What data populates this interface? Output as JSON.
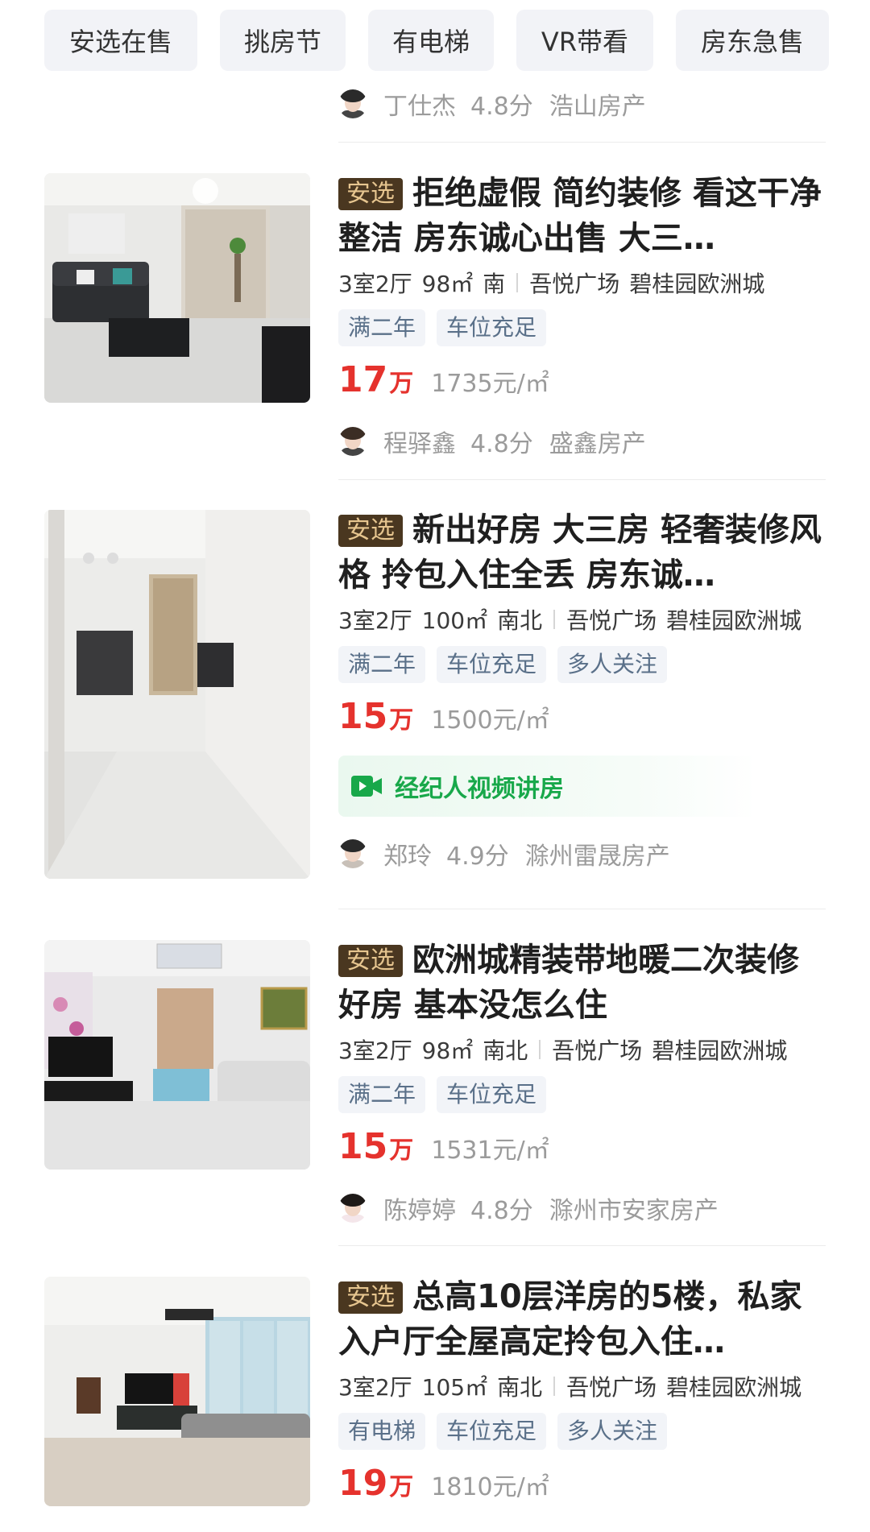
{
  "filters": [
    "安选在售",
    "挑房节",
    "有电梯",
    "VR带看",
    "房东急售"
  ],
  "top_agent": {
    "name": "丁仕杰",
    "score": "4.8分",
    "company": "浩山房产"
  },
  "badge_label": "安选",
  "price_unit": "万",
  "video_label": "经纪人视频讲房",
  "listings": [
    {
      "title": "拒绝虚假 简约装修 看这干净整洁 房东诚心出售 大三…",
      "layout": "3室2厅",
      "area": "98㎡",
      "orientation": "南",
      "district": "吾悦广场",
      "community": "碧桂园欧洲城",
      "tags": [
        "满二年",
        "车位充足"
      ],
      "price": "17",
      "unit_price": "1735元/㎡",
      "has_video": false,
      "agent": {
        "name": "程驿鑫",
        "score": "4.8分",
        "company": "盛鑫房产"
      }
    },
    {
      "title": "新出好房 大三房 轻奢装修风格 拎包入住全丢 房东诚…",
      "layout": "3室2厅",
      "area": "100㎡",
      "orientation": "南北",
      "district": "吾悦广场",
      "community": "碧桂园欧洲城",
      "tags": [
        "满二年",
        "车位充足",
        "多人关注"
      ],
      "price": "15",
      "unit_price": "1500元/㎡",
      "has_video": true,
      "agent": {
        "name": "郑玲",
        "score": "4.9分",
        "company": "滁州雷晟房产"
      }
    },
    {
      "title": "欧洲城精装带地暖二次装修好房 基本没怎么住",
      "layout": "3室2厅",
      "area": "98㎡",
      "orientation": "南北",
      "district": "吾悦广场",
      "community": "碧桂园欧洲城",
      "tags": [
        "满二年",
        "车位充足"
      ],
      "price": "15",
      "unit_price": "1531元/㎡",
      "has_video": false,
      "agent": {
        "name": "陈婷婷",
        "score": "4.8分",
        "company": "滁州市安家房产"
      }
    },
    {
      "title": "总高10层洋房的5楼，私家入户厅全屋高定拎包入住…",
      "layout": "3室2厅",
      "area": "105㎡",
      "orientation": "南北",
      "district": "吾悦广场",
      "community": "碧桂园欧洲城",
      "tags": [
        "有电梯",
        "车位充足",
        "多人关注"
      ],
      "price": "19",
      "unit_price": "1810元/㎡",
      "has_video": false
    }
  ]
}
